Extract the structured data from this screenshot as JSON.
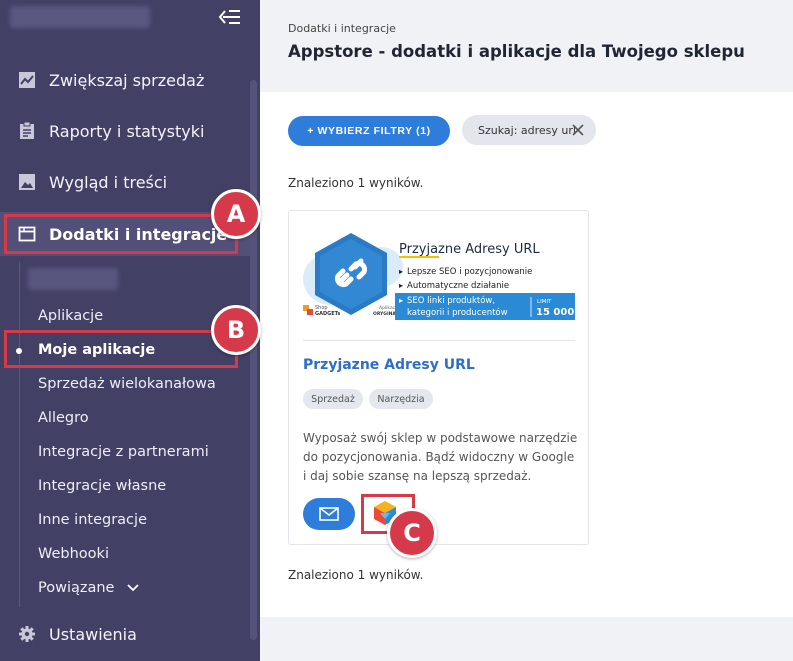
{
  "sidebar": {
    "nav": [
      {
        "label": "Zwiększaj sprzedaż",
        "icon": "trend-chart-icon"
      },
      {
        "label": "Raporty i statystyki",
        "icon": "clipboard-icon"
      },
      {
        "label": "Wygląd i treści",
        "icon": "image-icon"
      },
      {
        "label": "Dodatki i integracje",
        "icon": "window-icon"
      }
    ],
    "sub": [
      "Aplikacje",
      "Moje aplikacje",
      "Sprzedaż wielokanałowa",
      "Allegro",
      "Integracje z partnerami",
      "Integracje własne",
      "Inne integracje",
      "Webhooki",
      "Powiązane"
    ],
    "settings": {
      "label": "Ustawienia",
      "icon": "gear-icon"
    }
  },
  "header": {
    "breadcrumb": "Dodatki i integracje",
    "title": "Appstore - dodatki i aplikacje dla Twojego sklepu"
  },
  "main": {
    "filter_button": "+ WYBIERZ FILTRY (1)",
    "search_chip": "Szukaj: adresy url",
    "found_text": "Znaleziono 1 wyników.",
    "card": {
      "banner": {
        "title": "Przyjazne Adresy URL",
        "bullets": [
          "Lepsze SEO i pozycjonowanie",
          "Automatyczne działanie"
        ],
        "highlight": [
          "SEO linki produktów,",
          "kategorii i producentów"
        ],
        "limit_label": "LIMIT",
        "limit_value": "15 000",
        "badge_small": "Aplikacja",
        "badge_big": "ORYGINALNA",
        "brand_top": "Shop",
        "brand_bottom": "GADGETs"
      },
      "title": "Przyjazne Adresy URL",
      "tags": [
        "Sprzedaż",
        "Narzędzia"
      ],
      "description": "Wyposaż swój sklep w podstawowe narzędzie do pozycjonowania. Bądź widoczny w Google i daj sobie szansę na lepszą sprzedaż."
    }
  },
  "annotations": [
    "A",
    "B",
    "C"
  ],
  "colors": {
    "accent": "#2f7ddb",
    "annotation": "#d63a4a",
    "sidebar": "#434066"
  }
}
